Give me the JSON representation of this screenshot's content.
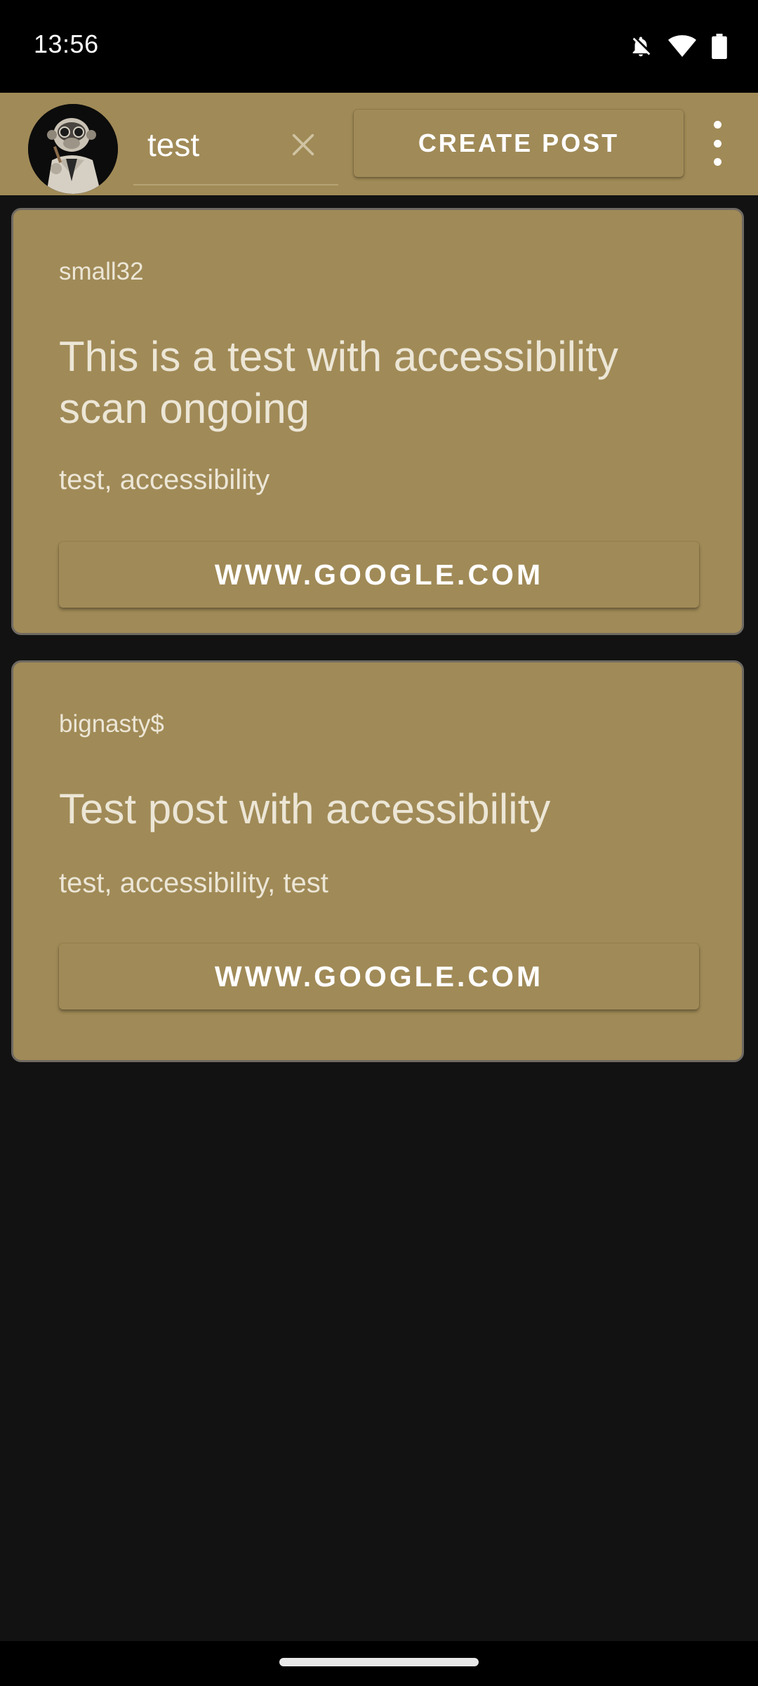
{
  "status_bar": {
    "time": "13:56",
    "icons": [
      "bell-off-icon",
      "wifi-icon",
      "battery-icon"
    ]
  },
  "app_bar": {
    "avatar_icon": "monkey-avatar-icon",
    "search": {
      "value": "test",
      "placeholder": ""
    },
    "clear_icon": "close-icon",
    "create_post_label": "CREATE POST",
    "menu_icon": "more-vert-icon"
  },
  "posts": [
    {
      "author": "small32",
      "title": "This is a test with accessibility scan ongoing",
      "tags": "test, accessibility",
      "link": "WWW.GOOGLE.COM"
    },
    {
      "author": "bignasty$",
      "title": "Test post with accessibility",
      "tags": "test, accessibility, test",
      "link": "WWW.GOOGLE.COM"
    }
  ],
  "colors": {
    "accent": "#a08a57",
    "background": "#121212",
    "card_border": "#6f6a62",
    "text_light": "#ece6d6"
  }
}
